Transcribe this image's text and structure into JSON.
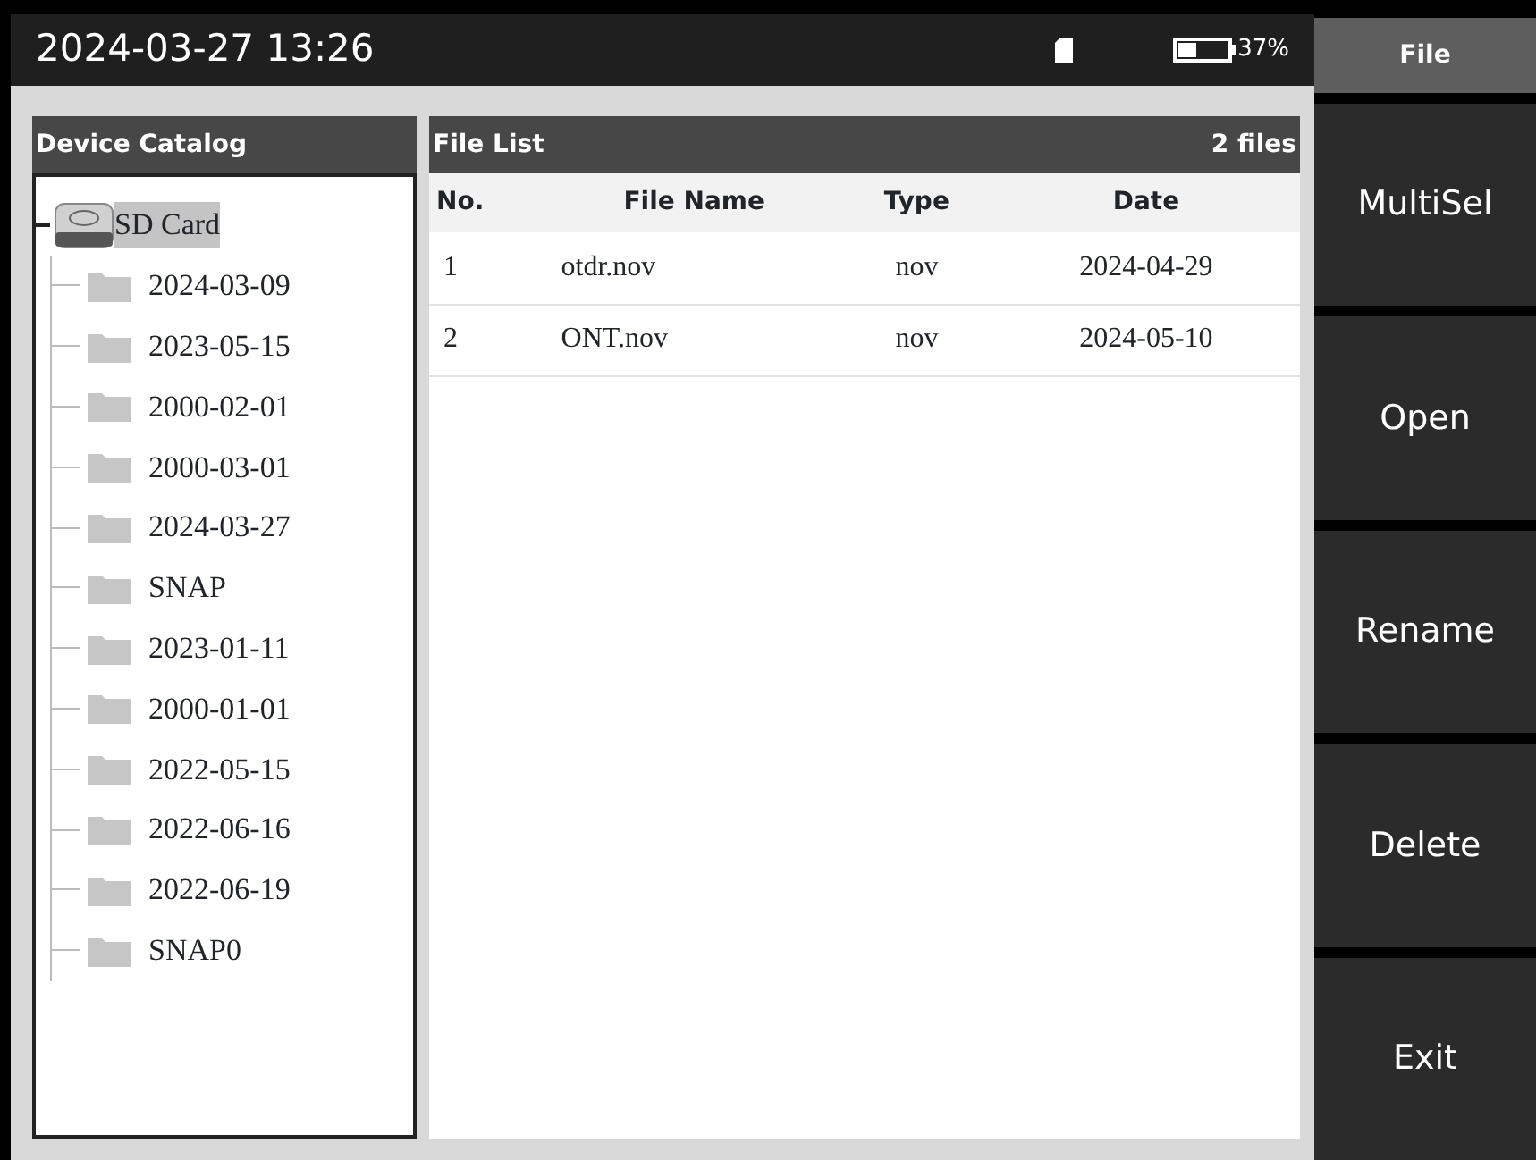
{
  "status_bar": {
    "datetime": "2024-03-27 13:26",
    "battery": {
      "level": 0.37,
      "text": "37%"
    }
  },
  "device_catalog": {
    "title": "Device Catalog",
    "tree": [
      {
        "label": "SD Card",
        "expanded": true,
        "selected": true,
        "children": [
          {
            "label": "2024-03-09"
          },
          {
            "label": "2023-05-15"
          },
          {
            "label": "2000-02-01"
          },
          {
            "label": "2000-03-01"
          },
          {
            "label": "2024-03-27"
          },
          {
            "label": "SNAP"
          },
          {
            "label": "2023-01-11"
          },
          {
            "label": "2000-01-01"
          },
          {
            "label": "2022-05-15"
          },
          {
            "label": "2022-06-16"
          },
          {
            "label": "2022-06-19"
          },
          {
            "label": "SNAP0"
          }
        ]
      }
    ]
  },
  "file_list": {
    "title": "File List",
    "count": "2 files",
    "columns": [
      "No.",
      "File Name",
      "Type",
      "Date"
    ],
    "rows": [
      [
        "1",
        "otdr.nov",
        "nov",
        "2024-04-29"
      ],
      [
        "2",
        "ONT.nov",
        "nov",
        "2024-05-10"
      ]
    ]
  },
  "menu": {
    "title": "File",
    "buttons": [
      "MultiSel",
      "Open",
      "Rename",
      "Delete",
      "Exit"
    ]
  }
}
